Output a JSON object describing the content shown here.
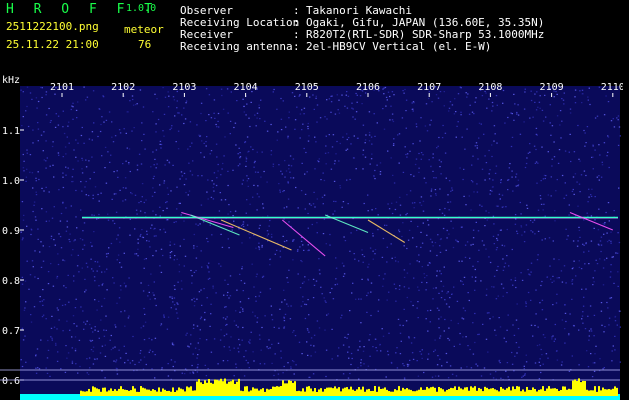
{
  "header": {
    "app_name": "H R O F F T",
    "version": "1.0.0",
    "filename": "2511222100.png",
    "datetime": "25.11.22 21:00",
    "meteor_label": "meteor",
    "meteor_count": "76",
    "info": [
      {
        "label": "Observer",
        "sep": ":",
        "value": "Takanori Kawachi"
      },
      {
        "label": "Receiving Location",
        "sep": ":",
        "value": "Ogaki, Gifu, JAPAN (136.60E, 35.35N)"
      },
      {
        "label": "Receiver",
        "sep": ":",
        "value": "R820T2(RTL-SDR) SDR-Sharp 53.1000MHz"
      },
      {
        "label": "Receiving antenna",
        "sep": ":",
        "value": "2el-HB9CV Vertical (el. E-W)"
      }
    ]
  },
  "chart_data": {
    "type": "heatmap",
    "ylabel": "kHz",
    "x_ticks": [
      "2101",
      "2102",
      "2103",
      "2104",
      "2105",
      "2106",
      "2107",
      "2108",
      "2109",
      "2110"
    ],
    "y_ticks": [
      "1.1",
      "1.0",
      "0.9",
      "0.8",
      "0.7",
      "0.6"
    ],
    "ylim": [
      0.6,
      1.18
    ],
    "carrier_khz": 0.925,
    "meteor_traces": [
      {
        "x_start": 2102.95,
        "x_end": 2103.8,
        "y_start": 0.935,
        "y_end": 0.905
      },
      {
        "x_start": 2103.1,
        "x_end": 2103.9,
        "y_start": 0.93,
        "y_end": 0.89
      },
      {
        "x_start": 2103.6,
        "x_end": 2104.75,
        "y_start": 0.92,
        "y_end": 0.86
      },
      {
        "x_start": 2104.6,
        "x_end": 2105.3,
        "y_start": 0.92,
        "y_end": 0.848
      },
      {
        "x_start": 2105.3,
        "x_end": 2106.0,
        "y_start": 0.93,
        "y_end": 0.895
      },
      {
        "x_start": 2106.0,
        "x_end": 2106.6,
        "y_start": 0.92,
        "y_end": 0.875
      },
      {
        "x_start": 2109.3,
        "x_end": 2110.0,
        "y_start": 0.935,
        "y_end": 0.9
      }
    ]
  },
  "colors": {
    "green_text": "#19ff4a",
    "yellow_text": "#ffff33",
    "background_noise": "#1a1a8c",
    "carrier": "#33ffcc",
    "bottom_bar": "#ffff00",
    "bottom_base": "#00ffff"
  }
}
